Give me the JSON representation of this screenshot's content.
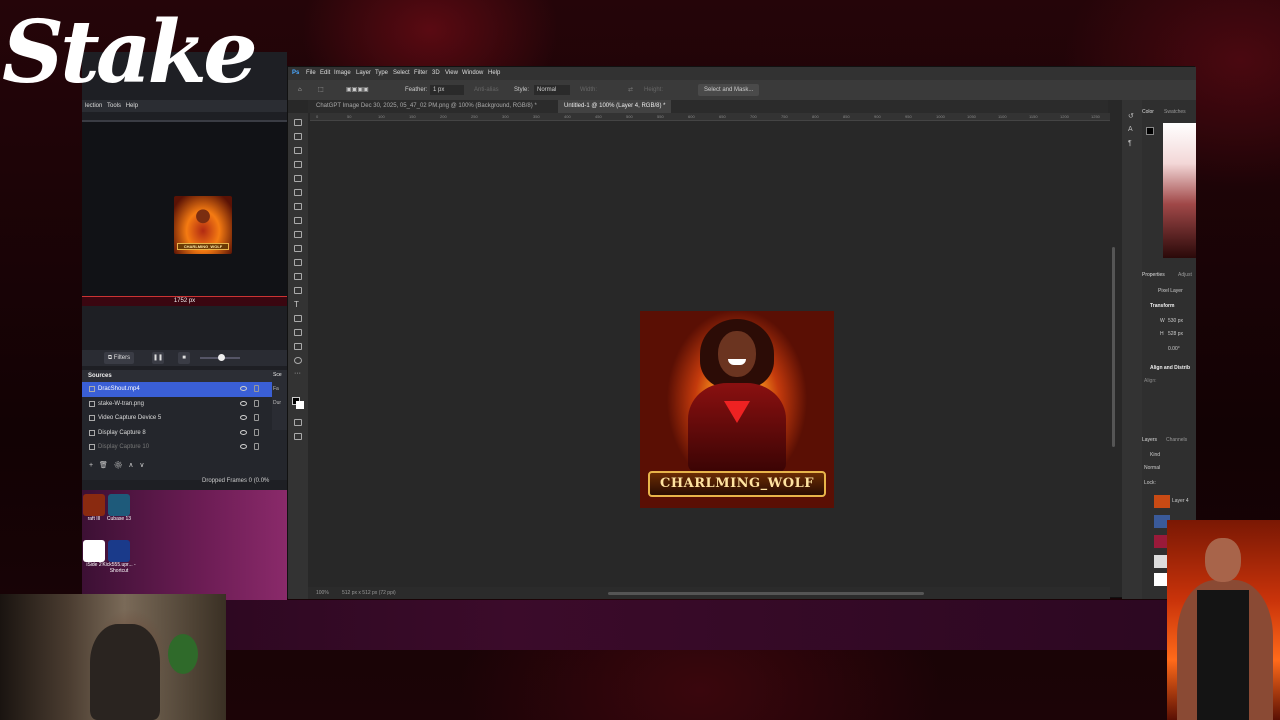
{
  "brand": {
    "logo_text": "Stake"
  },
  "obs": {
    "menu": [
      "lection",
      "Tools",
      "Help"
    ],
    "preview_resolution": "1752 px",
    "thumb_name": "CHARLMING_WOLF",
    "controls": {
      "filters_label": "Filters"
    },
    "sources_title": "Sources",
    "scenes_fragment": "Sce",
    "scene_col_labels": [
      "Fa",
      "Dur"
    ],
    "sources": [
      {
        "label": "DracShout.mp4",
        "selected": true,
        "dim": false
      },
      {
        "label": "stake-W-tran.png",
        "selected": false,
        "dim": false
      },
      {
        "label": "Video Capture Device 5",
        "selected": false,
        "dim": false
      },
      {
        "label": "Display Capture 8",
        "selected": false,
        "dim": false
      },
      {
        "label": "Display Capture 10",
        "selected": false,
        "dim": true
      }
    ],
    "dropped_frames": "Dropped Frames 0 (0.0%"
  },
  "desktop_icons": [
    {
      "label": "raft III",
      "color": "#8a2a10"
    },
    {
      "label": "Cubase 13",
      "color": "#1e5a7a"
    },
    {
      "label": "iSide 2",
      "color": "#ffffff"
    },
    {
      "label": "Kick555.upr... - Shortcut",
      "color": "#1a3a8a"
    }
  ],
  "photoshop": {
    "menu": [
      "File",
      "Edit",
      "Image",
      "Layer",
      "Type",
      "Select",
      "Filter",
      "3D",
      "View",
      "Window",
      "Help"
    ],
    "options": {
      "feather_label": "Feather:",
      "feather_value": "1 px",
      "antialias": "Anti-alias",
      "style_label": "Style:",
      "style_value": "Normal",
      "width_label": "Width:",
      "height_label": "Height:",
      "select_mask": "Select and Mask..."
    },
    "tabs": [
      {
        "label": "ChatGPT Image Dec 30, 2025, 05_47_02 PM.png @ 100% (Background, RGB/8) *",
        "active": false
      },
      {
        "label": "Untitled-1 @ 100% (Layer 4, RGB/8) *",
        "active": true
      }
    ],
    "ruler_ticks": [
      "0",
      "50",
      "100",
      "150",
      "200",
      "250",
      "300",
      "350",
      "400",
      "450",
      "500",
      "550",
      "600",
      "650",
      "700",
      "750",
      "800",
      "850",
      "900",
      "950",
      "1000",
      "1050",
      "1100",
      "1150",
      "1200",
      "1250"
    ],
    "canvas_art_text": "CHARLMING_WOLF",
    "status": {
      "zoom": "100%",
      "doc_size": "512 px x 512 px (72 ppi)"
    },
    "right_panel": {
      "color_tab": "Color",
      "swatches_tab": "Swatches",
      "properties_tab": "Properties",
      "adjust_tab": "Adjust",
      "pixel_layer": "Pixel Layer",
      "transform": "Transform",
      "w_label": "W",
      "w_value": "530 px",
      "h_label": "H",
      "h_value": "528 px",
      "angle": "0.00°",
      "align": "Align and Distrib",
      "align_sub": "Align:",
      "layers_tab": "Layers",
      "channels_tab": "Channels",
      "kind": "Kind",
      "blend": "Normal",
      "lock": "Lock:",
      "layer4": "Layer 4"
    }
  }
}
